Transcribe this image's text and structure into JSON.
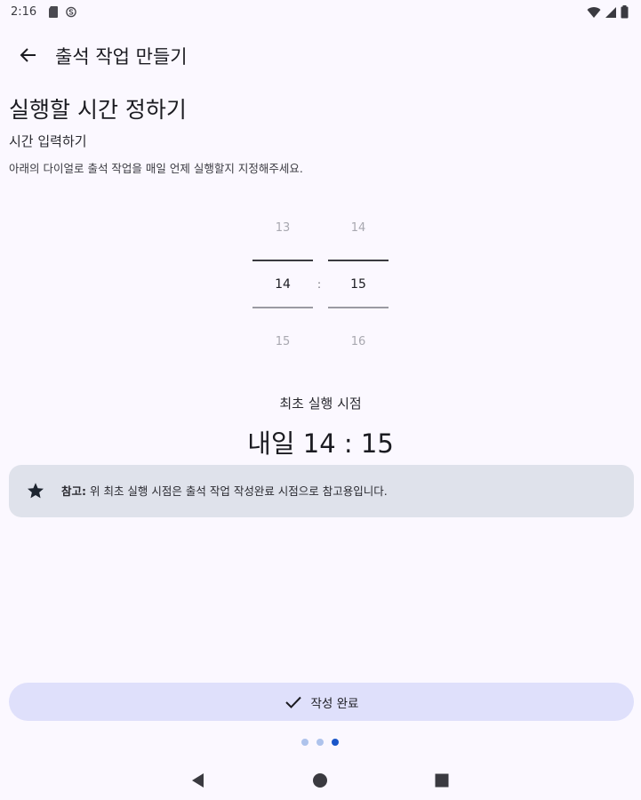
{
  "status_bar": {
    "time": "2:16",
    "left_icons": [
      "sim-card-icon",
      "circle-s-icon"
    ],
    "right_icons": [
      "wifi-icon",
      "cell-signal-icon",
      "battery-icon"
    ]
  },
  "app_bar": {
    "back_icon": "arrow-left-icon",
    "title": "출석 작업 만들기"
  },
  "content": {
    "section_title": "실행할 시간 정하기",
    "subtitle": "시간 입력하기",
    "description": "아래의 다이얼로 출석 작업을 매일 언제 실행할지 지정해주세요."
  },
  "time_picker": {
    "hour": {
      "prev": "13",
      "selected": "14",
      "next": "15"
    },
    "minute": {
      "prev": "14",
      "selected": "15",
      "next": "16"
    },
    "separator": ":"
  },
  "first_run": {
    "label": "최초 실행 시점",
    "value": "내일 14 : 15"
  },
  "note": {
    "icon": "star-icon",
    "prefix": "참고:",
    "text": " 위 최초 실행 시점은 출석 작업 작성완료 시점으로 참고용입니다."
  },
  "complete_button": {
    "icon": "check-icon",
    "label": "작성 완료"
  },
  "page_indicator": {
    "total": 3,
    "active_index": 2
  },
  "colors": {
    "background": "#fbf8ff",
    "note_card": "#dfe2eb",
    "button_bg": "#dfe0fb",
    "dot_inactive": "#aec3ec",
    "dot_active": "#1a56c9",
    "picker_line_selected": "#3a3a40",
    "picker_line_bottom": "#9a9aa2"
  },
  "nav_bar": {
    "back": "triangle-back-icon",
    "home": "circle-home-icon",
    "recents": "square-recents-icon"
  }
}
